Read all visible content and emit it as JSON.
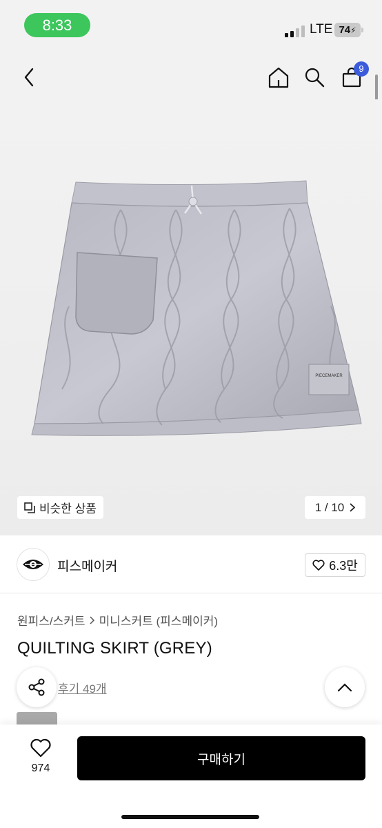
{
  "status_bar": {
    "time": "8:33",
    "network": "LTE",
    "battery": "74"
  },
  "header": {
    "back_icon": "chevron-left-icon",
    "home_icon": "home-icon",
    "search_icon": "search-icon",
    "cart_icon": "shopping-bag-icon",
    "cart_count": "9"
  },
  "hero": {
    "similar_label": "비슷한 상품",
    "pager": "1 / 10",
    "product_label_text": "PIECEMAKER"
  },
  "brand": {
    "name": "피스메이커",
    "likes": "6.3만"
  },
  "breadcrumb": {
    "category": "원피스/스커트",
    "subcategory": "미니스커트 (피스메이커)"
  },
  "product": {
    "title": "QUILTING SKIRT (GREY)",
    "reviews": "후기 49개"
  },
  "bottom": {
    "wish_count": "974",
    "buy_label": "구매하기"
  },
  "colors": {
    "accent_green": "#3cc65c",
    "badge_blue": "#3b5bdb",
    "buy_button": "#000000"
  }
}
